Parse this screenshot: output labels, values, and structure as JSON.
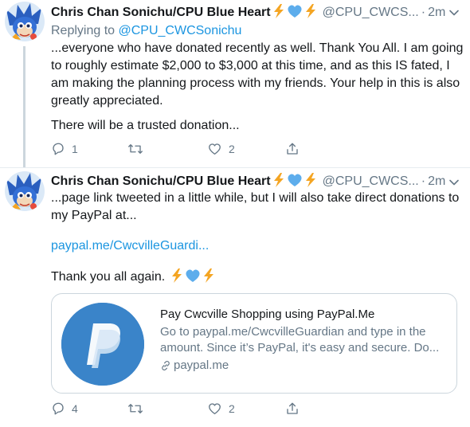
{
  "tweets": [
    {
      "name": "Chris Chan Sonichu/CPU Blue Heart",
      "handle": "@CPU_CWCS...",
      "dot": "·",
      "time": "2m",
      "replying_prefix": "Replying to ",
      "replying_to": "@CPU_CWCSonichu",
      "text_p1": "...everyone who have donated recently as well. Thank You All. I am going to roughly estimate $2,000 to $3,000 at this time, and as this IS fated, I am making the planning process with my friends. Your help in this is also greatly appreciated.",
      "text_p2": "There will be a trusted donation...",
      "reply_count": "1",
      "retweet_count": "",
      "like_count": "2"
    },
    {
      "name": "Chris Chan Sonichu/CPU Blue Heart",
      "handle": "@CPU_CWCS...",
      "dot": "·",
      "time": "2m",
      "text_p1": "...page link tweeted in a little while, but I will also take direct donations to my PayPal at...",
      "link": "paypal.me/CwcvilleGuardi...",
      "text_p3": "Thank you all again.",
      "card": {
        "title": "Pay Cwcville Shopping using PayPal.Me",
        "description": "Go to paypal.me/CwcvilleGuardian and type in the amount. Since it’s PayPal, it's easy and secure. Do...",
        "domain": "paypal.me"
      },
      "reply_count": "4",
      "retweet_count": "",
      "like_count": "2"
    }
  ],
  "icons": {
    "badge": [
      "lightning-emoji",
      "blue-heart-emoji",
      "lightning-emoji"
    ],
    "actions": [
      "reply-icon",
      "retweet-icon",
      "like-icon",
      "share-icon"
    ]
  },
  "colors": {
    "link": "#1b95e0",
    "muted": "#657786",
    "text": "#14171a",
    "lightning": "#f4a523",
    "heart": "#5dadec",
    "paypal": "#3a84c9"
  }
}
